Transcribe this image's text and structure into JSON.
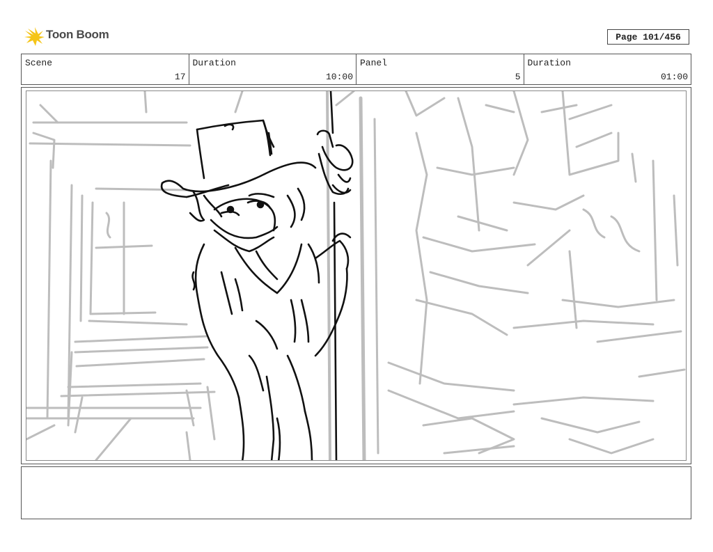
{
  "header": {
    "brand": "Toon Boom",
    "page_label": "Page 101/456"
  },
  "info": {
    "scene_label": "Scene",
    "scene_value": "17",
    "scene_duration_label": "Duration",
    "scene_duration_value": "10:00",
    "panel_label": "Panel",
    "panel_value": "5",
    "panel_duration_label": "Duration",
    "panel_duration_value": "01:00"
  },
  "notes": {
    "text": ""
  },
  "colors": {
    "logo_yellow": "#f5c518",
    "sketch_gray": "#bdbdbd",
    "ink": "#111111"
  }
}
